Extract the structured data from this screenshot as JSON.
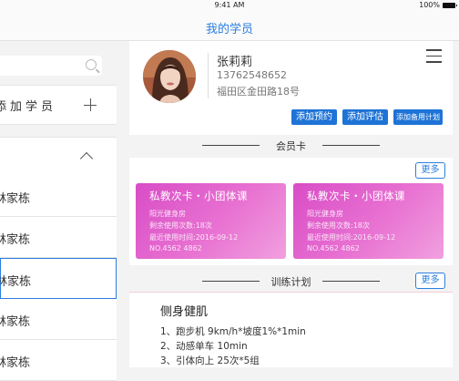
{
  "status": {
    "time": "9:41 AM",
    "battery": "100%"
  },
  "nav": {
    "title": "我的学员"
  },
  "sidebar": {
    "search_placeholder": "",
    "add_label": "添加学员",
    "students": [
      {
        "name": "林家栋"
      },
      {
        "name": "林家栋"
      },
      {
        "name": "林家栋"
      },
      {
        "name": "林家栋"
      },
      {
        "name": "林家栋"
      }
    ]
  },
  "profile": {
    "name": "张莉莉",
    "phone": "13762548652",
    "address": "福田区金田路18号",
    "buttons": [
      "添加预约",
      "添加评估",
      "添加备用计划"
    ]
  },
  "membership": {
    "section_title": "会员卡",
    "more_label": "更多",
    "cards": [
      {
        "title": "私教次卡・小团体课",
        "gym": "阳光健身房",
        "remaining": "剩余使用次数:18次",
        "last_used": "最近使用时间:2016-09-12",
        "number": "NO.4562  4862"
      },
      {
        "title": "私教次卡・小团体课",
        "gym": "阳光健身房",
        "remaining": "剩余使用次数:18次",
        "last_used": "最近使用时间:2016-09-12",
        "number": "NO.4562  4862"
      }
    ]
  },
  "training": {
    "section_title": "训练计划",
    "more_label": "更多",
    "plan_title": "侧身健肌",
    "items": [
      "1、跑步机 9km/h*坡度1%*1min",
      "2、动感单车 10min",
      "3、引体向上 25次*5组"
    ]
  },
  "colors": {
    "accent": "#2a7ee0",
    "button": "#1e73d6",
    "card": "#e06fd0"
  }
}
